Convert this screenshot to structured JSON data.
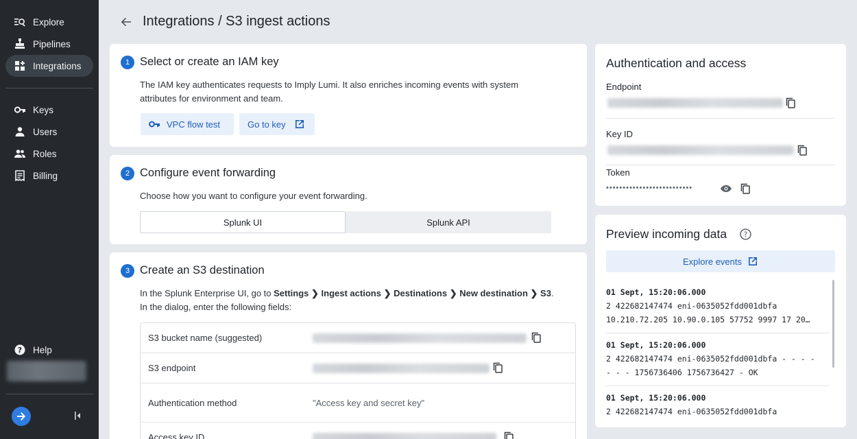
{
  "sidebar": {
    "items": [
      {
        "label": "Explore",
        "icon": "explore-icon"
      },
      {
        "label": "Pipelines",
        "icon": "pipelines-icon"
      },
      {
        "label": "Integrations",
        "icon": "integrations-icon",
        "active": true
      },
      {
        "label": "Keys",
        "icon": "key-icon"
      },
      {
        "label": "Users",
        "icon": "user-icon"
      },
      {
        "label": "Roles",
        "icon": "roles-icon"
      },
      {
        "label": "Billing",
        "icon": "billing-icon"
      }
    ],
    "help_label": "Help"
  },
  "header": {
    "title": "Integrations / S3 ingest actions"
  },
  "step1": {
    "number": "1",
    "title": "Select or create an IAM key",
    "description": "The IAM key authenticates requests to Imply Lumi. It also enriches incoming events with system attributes for environment and team.",
    "key_button": "VPC flow test",
    "goto_button": "Go to key"
  },
  "step2": {
    "number": "2",
    "title": "Configure event forwarding",
    "description": "Choose how you want to configure your event forwarding.",
    "tabs": [
      "Splunk UI",
      "Splunk API"
    ],
    "selected_tab": "Splunk UI"
  },
  "step3": {
    "number": "3",
    "title": "Create an S3 destination",
    "intro_prefix": "In the Splunk Enterprise UI, go to ",
    "path": [
      "Settings",
      "Ingest actions",
      "Destinations",
      "New destination",
      "S3"
    ],
    "intro_line2": "In the dialog, enter the following fields:",
    "fields": [
      {
        "label": "S3 bucket name (suggested)"
      },
      {
        "label": "S3 endpoint"
      },
      {
        "label": "Authentication method",
        "value": "\"Access key and secret key\""
      },
      {
        "label": "Access key ID"
      }
    ]
  },
  "auth": {
    "title": "Authentication and access",
    "endpoint_label": "Endpoint",
    "key_id_label": "Key ID",
    "token_label": "Token",
    "token_mask": "••••••••••••••••••••••••••"
  },
  "preview": {
    "title": "Preview incoming data",
    "explore_button": "Explore events",
    "events": [
      {
        "ts": "01 Sept, 15:20:06.000",
        "lines": [
          "2 422682147474 eni-0635052fdd001dbfa",
          "10.210.72.205 10.90.0.105 57752 9997 17 20…"
        ]
      },
      {
        "ts": "01 Sept, 15:20:06.000",
        "lines": [
          "2 422682147474 eni-0635052fdd001dbfa - - - -",
          "- - - 1756736406 1756736427 - OK"
        ]
      },
      {
        "ts": "01 Sept, 15:20:06.000",
        "lines": [
          "2 422682147474 eni-0635052fdd001dbfa"
        ]
      }
    ]
  },
  "colors": {
    "accent": "#1f6fd1",
    "sidebar_bg": "#25292e",
    "page_bg": "#e5e9ee"
  }
}
